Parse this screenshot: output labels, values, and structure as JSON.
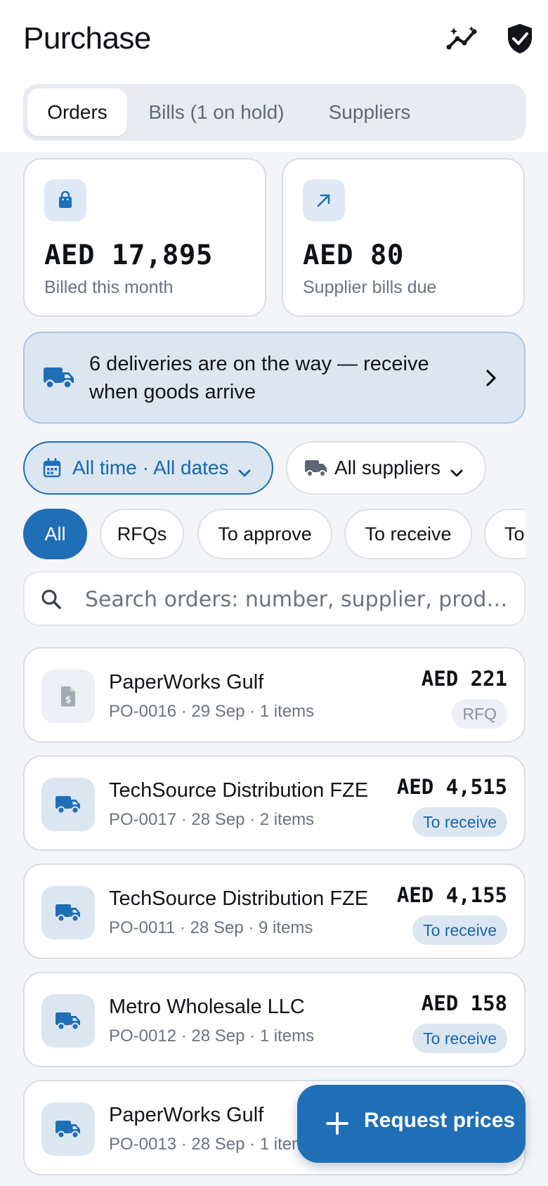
{
  "header": {
    "title": "Purchase",
    "icons": [
      "insights-icon",
      "shield-check-icon"
    ]
  },
  "tabs": [
    {
      "label": "Orders",
      "active": true
    },
    {
      "label": "Bills (1 on hold)",
      "active": false
    },
    {
      "label": "Suppliers",
      "active": false
    }
  ],
  "stats": [
    {
      "icon": "shopping-bag-icon",
      "value": "AED 17,895",
      "label": "Billed this month"
    },
    {
      "icon": "arrow-up-right-icon",
      "value": "AED 80",
      "label": "Supplier bills due"
    }
  ],
  "banner": {
    "icon": "truck-icon",
    "text": "6 deliveries are on the way — receive when goods arrive"
  },
  "filters": {
    "date": "All time · All dates",
    "supplier": "All suppliers"
  },
  "chips": [
    {
      "label": "All",
      "active": true
    },
    {
      "label": "RFQs",
      "active": false
    },
    {
      "label": "To approve",
      "active": false
    },
    {
      "label": "To receive",
      "active": false
    },
    {
      "label": "To",
      "active": false
    }
  ],
  "search": {
    "placeholder": "Search orders: number, supplier, prod…"
  },
  "orders": [
    {
      "supplier": "PaperWorks Gulf",
      "meta": "PO-0016 · 29 Sep · 1 items",
      "amount": "AED 221",
      "status": "RFQ",
      "icon": "invoice-icon"
    },
    {
      "supplier": "TechSource Distribution FZE",
      "meta": "PO-0017 · 28 Sep · 2 items",
      "amount": "AED 4,515",
      "status": "To receive",
      "icon": "truck-icon"
    },
    {
      "supplier": "TechSource Distribution FZE",
      "meta": "PO-0011 · 28 Sep · 9 items",
      "amount": "AED 4,155",
      "status": "To receive",
      "icon": "truck-icon"
    },
    {
      "supplier": "Metro Wholesale LLC",
      "meta": "PO-0012 · 28 Sep · 1 items",
      "amount": "AED 158",
      "status": "To receive",
      "icon": "truck-icon"
    },
    {
      "supplier": "PaperWorks Gulf",
      "meta": "PO-0013 · 28 Sep · 1 items",
      "amount": "",
      "status": "",
      "icon": "truck-icon"
    }
  ],
  "fab": {
    "label": "Request prices",
    "icon": "plus-icon"
  },
  "colors": {
    "accent": "#1f6fb6",
    "accent_soft": "#dbe6f1",
    "text": "#111418",
    "muted": "#6b7480"
  }
}
